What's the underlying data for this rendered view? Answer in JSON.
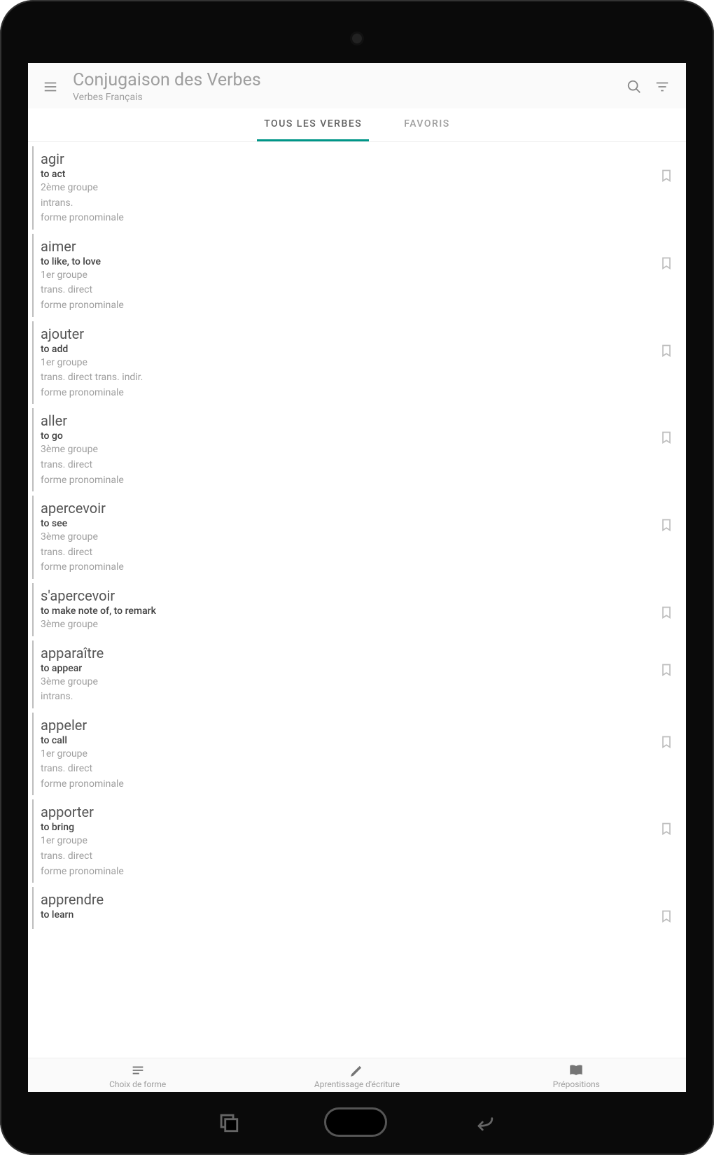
{
  "header": {
    "title": "Conjugaison des Verbes",
    "subtitle": "Verbes Français"
  },
  "tabs": [
    {
      "label": "TOUS LES VERBES",
      "active": true
    },
    {
      "label": "FAVORIS",
      "active": false
    }
  ],
  "verbs": [
    {
      "word": "agir",
      "translation": "to act",
      "meta": [
        "2ème groupe",
        "intrans.",
        "forme pronominale"
      ]
    },
    {
      "word": "aimer",
      "translation": "to like, to love",
      "meta": [
        "1er groupe",
        "trans. direct",
        "forme pronominale"
      ]
    },
    {
      "word": "ajouter",
      "translation": "to add",
      "meta": [
        "1er groupe",
        "trans. direct  trans. indir.",
        "forme pronominale"
      ]
    },
    {
      "word": "aller",
      "translation": "to go",
      "meta": [
        "3ème groupe",
        "trans. direct",
        "forme pronominale"
      ]
    },
    {
      "word": "apercevoir",
      "translation": "to see",
      "meta": [
        "3ème groupe",
        "trans. direct",
        "forme pronominale"
      ]
    },
    {
      "word": "s'apercevoir",
      "translation": "to make note of, to remark",
      "meta": [
        "3ème groupe"
      ]
    },
    {
      "word": "apparaître",
      "translation": "to appear",
      "meta": [
        "3ème groupe",
        "intrans."
      ]
    },
    {
      "word": "appeler",
      "translation": "to call",
      "meta": [
        "1er groupe",
        "trans. direct",
        "forme pronominale"
      ]
    },
    {
      "word": "apporter",
      "translation": "to bring",
      "meta": [
        "1er groupe",
        "trans. direct",
        "forme pronominale"
      ]
    },
    {
      "word": "apprendre",
      "translation": "to learn",
      "meta": []
    }
  ],
  "bottom": [
    {
      "label": "Choix de forme",
      "icon": "list"
    },
    {
      "label": "Aprentissage d'écriture",
      "icon": "pencil"
    },
    {
      "label": "Prépositions",
      "icon": "book"
    }
  ]
}
